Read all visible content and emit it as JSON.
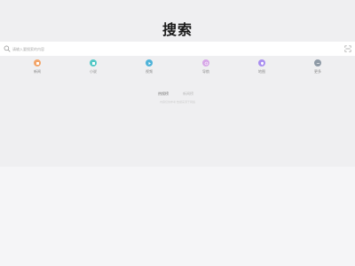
{
  "logo": {
    "text": "搜索"
  },
  "search": {
    "placeholder": "请输入要搜索的内容",
    "value": ""
  },
  "categories": [
    {
      "label": "新闻",
      "color": "#f2a469",
      "icon": "news-icon"
    },
    {
      "label": "小说",
      "color": "#54c8c6",
      "icon": "book-icon"
    },
    {
      "label": "视频",
      "color": "#4fb3d9",
      "icon": "video-icon"
    },
    {
      "label": "导航",
      "color": "#d7a6e8",
      "icon": "compass-icon"
    },
    {
      "label": "地图",
      "color": "#a98ef0",
      "icon": "map-icon"
    },
    {
      "label": "更多",
      "color": "#8e9aa6",
      "icon": "more-icon"
    }
  ],
  "tabs": [
    {
      "label": "热搜榜",
      "active": true
    },
    {
      "label": "新闻榜",
      "active": false
    }
  ],
  "footnote": "内容仅供参考 数据来源于网络"
}
